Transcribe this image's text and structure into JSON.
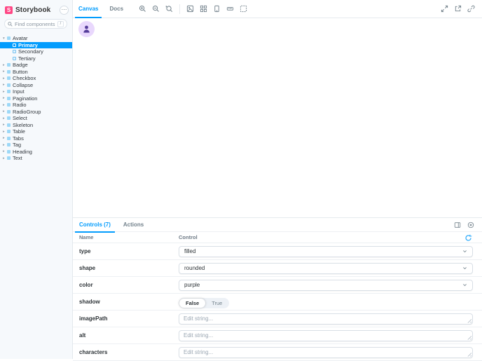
{
  "app": {
    "title": "Storybook"
  },
  "colors": {
    "accent_blue": "#029CFD",
    "brand_pink": "#FF4785",
    "sidebar_bg": "#F6F9FC",
    "selected_item_bg": "#029CFD",
    "avatar_bg": "#E9D8FD",
    "avatar_fg": "#553C9A"
  },
  "icons": {
    "search-icon": "magnifier",
    "menu-icon": "⋯",
    "shortcut-key": "/",
    "zoom-in-icon": "magnifier-plus",
    "zoom-out-icon": "magnifier-minus",
    "zoom-reset-icon": "magnifier-reset",
    "background-icon": "photo",
    "grid-icon": "grid",
    "viewport-icon": "device",
    "measure-icon": "ruler",
    "outline-icon": "dashed-box",
    "fullscreen-icon": "expand-arrows",
    "open-new-tab-icon": "box-arrow",
    "link-icon": "chain",
    "panel-position-icon": "dock-side",
    "close-panel-icon": "circle-x",
    "reset-controls-icon": "circular-arrow",
    "chevron-down-icon": "⌄",
    "caret-down-icon": "▾",
    "caret-right-icon": "▸",
    "avatar-person-icon": "person"
  },
  "sidebar": {
    "brand": "Storybook",
    "menu_button": "⋯",
    "search": {
      "placeholder": "Find components",
      "shortcut": "/"
    },
    "tree": [
      {
        "label": "Avatar",
        "expanded": true,
        "children": [
          {
            "label": "Primary",
            "selected": true
          },
          {
            "label": "Secondary",
            "selected": false
          },
          {
            "label": "Tertiary",
            "selected": false
          }
        ]
      },
      {
        "label": "Badge"
      },
      {
        "label": "Button"
      },
      {
        "label": "Checkbox"
      },
      {
        "label": "Collapse"
      },
      {
        "label": "Input"
      },
      {
        "label": "Pagination"
      },
      {
        "label": "Radio"
      },
      {
        "label": "RadioGroup"
      },
      {
        "label": "Select"
      },
      {
        "label": "Skeleton"
      },
      {
        "label": "Table"
      },
      {
        "label": "Tabs"
      },
      {
        "label": "Tag"
      },
      {
        "label": "Heading"
      },
      {
        "label": "Text"
      }
    ]
  },
  "toolbar": {
    "tabs": [
      {
        "label": "Canvas",
        "active": true
      },
      {
        "label": "Docs",
        "active": false
      }
    ]
  },
  "canvas": {
    "preview": "avatar-component"
  },
  "panel": {
    "tabs": [
      {
        "label": "Controls (7)",
        "active": true
      },
      {
        "label": "Actions",
        "active": false
      }
    ],
    "table": {
      "name_header": "Name",
      "control_header": "Control"
    },
    "rows": [
      {
        "name": "type",
        "control": "select",
        "value": "filled"
      },
      {
        "name": "shape",
        "control": "select",
        "value": "rounded"
      },
      {
        "name": "color",
        "control": "select",
        "value": "purple"
      },
      {
        "name": "shadow",
        "control": "toggle",
        "options": [
          "False",
          "True"
        ],
        "value": "False"
      },
      {
        "name": "imagePath",
        "control": "text",
        "placeholder": "Edit string..."
      },
      {
        "name": "alt",
        "control": "text",
        "placeholder": "Edit string..."
      },
      {
        "name": "characters",
        "control": "text",
        "placeholder": "Edit string..."
      }
    ]
  }
}
